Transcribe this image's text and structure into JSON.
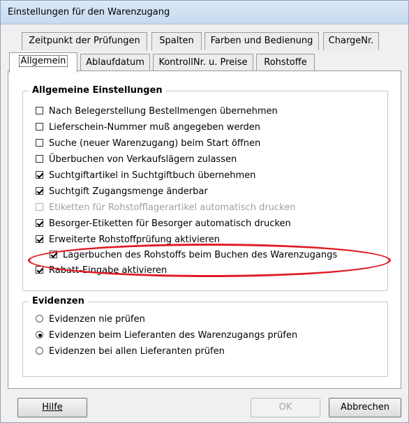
{
  "window": {
    "title": "Einstellungen für den Warenzugang"
  },
  "tabs_back": [
    {
      "label": "Zeitpunkt der Prüfungen"
    },
    {
      "label": "Spalten"
    },
    {
      "label": "Farben und Bedienung"
    },
    {
      "label": "ChargeNr."
    }
  ],
  "tabs_front": [
    {
      "label": "Allgemein",
      "active": true
    },
    {
      "label": "Ablaufdatum"
    },
    {
      "label": "KontrollNr. u. Preise"
    },
    {
      "label": "Rohstoffe"
    }
  ],
  "general": {
    "legend": "Allgemeine Einstellungen",
    "options": [
      {
        "label": "Nach Belegerstellung Bestellmengen übernehmen",
        "checked": false
      },
      {
        "label": "Lieferschein-Nummer muß angegeben werden",
        "checked": false
      },
      {
        "label": "Suche (neuer Warenzugang) beim Start öffnen",
        "checked": false
      },
      {
        "label": "Überbuchen von Verkaufslägern zulassen",
        "checked": false
      },
      {
        "label": "Suchtgiftartikel in Suchtgiftbuch übernehmen",
        "checked": true
      },
      {
        "label": "Suchtgift Zugangsmenge änderbar",
        "checked": true
      },
      {
        "label": "Etiketten für Rohstofflagerartikel automatisch drucken",
        "checked": false,
        "disabled": true
      },
      {
        "label": "Besorger-Etiketten für Besorger automatisch drucken",
        "checked": true
      },
      {
        "label": "Erweiterte Rohstoffprüfung aktivieren",
        "checked": true
      },
      {
        "label": "Lagerbuchen des Rohstoffs beim Buchen des Warenzugangs",
        "checked": true,
        "indented": true,
        "highlighted": true
      },
      {
        "label": "Rabatt-Eingabe aktivieren",
        "checked": true
      }
    ]
  },
  "evidence": {
    "legend": "Evidenzen",
    "options": [
      {
        "label": "Evidenzen nie prüfen",
        "selected": false
      },
      {
        "label": "Evidenzen beim Lieferanten des Warenzugangs prüfen",
        "selected": true
      },
      {
        "label": "Evidenzen bei allen Lieferanten prüfen",
        "selected": false
      }
    ]
  },
  "buttons": {
    "help": "Hilfe",
    "ok": "OK",
    "cancel": "Abbrechen"
  },
  "colors": {
    "highlight_oval": "#e01b24"
  }
}
